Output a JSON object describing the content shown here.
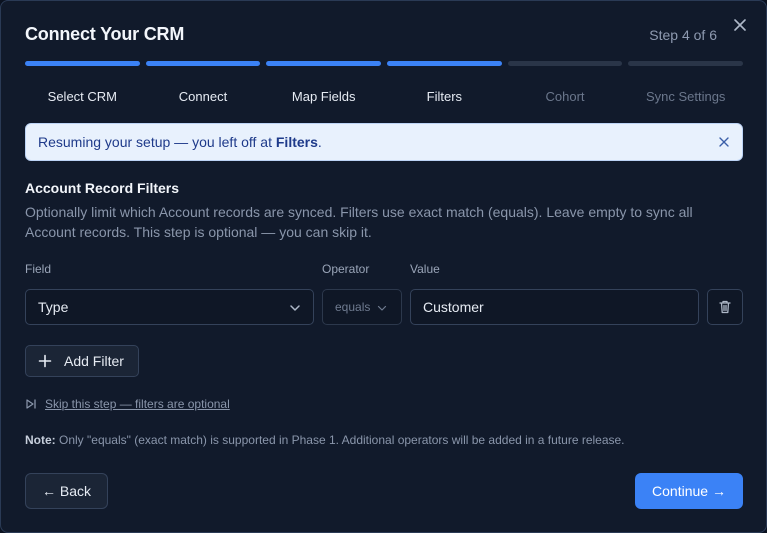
{
  "dialog": {
    "title": "Connect Your CRM",
    "step_count": "Step 4 of 6"
  },
  "progress": {
    "completed_steps": 4,
    "total_steps": 6
  },
  "steps": [
    {
      "label": "Select CRM"
    },
    {
      "label": "Connect"
    },
    {
      "label": "Map Fields"
    },
    {
      "label": "Filters"
    },
    {
      "label": "Cohort"
    },
    {
      "label": "Sync Settings"
    }
  ],
  "banner": {
    "text": "Resuming your setup — you left off at ",
    "step": "Filters",
    "suffix": "."
  },
  "section": {
    "title": "Account Record Filters",
    "description": "Optionally limit which Account records are synced. Filters use exact match (equals). Leave empty to sync all Account records. This step is optional — you can skip it."
  },
  "filters": {
    "field_label": "Field",
    "operator_label": "Operator",
    "value_label": "Value",
    "row": {
      "field": "Type",
      "operator": "equals",
      "value": "Customer"
    },
    "add_label": "Add Filter"
  },
  "skip_label": "Skip this step — filters are optional",
  "note": {
    "prefix": "Note:",
    "text": " Only \"equals\" (exact match) is supported in Phase 1. Additional operators will be added in a future release."
  },
  "footer": {
    "back_label": "← Back",
    "continue_label": "Continue →"
  },
  "colors": {
    "accent": "#3b82f6",
    "background": "#111a2b",
    "banner_bg": "#e8f1fd"
  }
}
